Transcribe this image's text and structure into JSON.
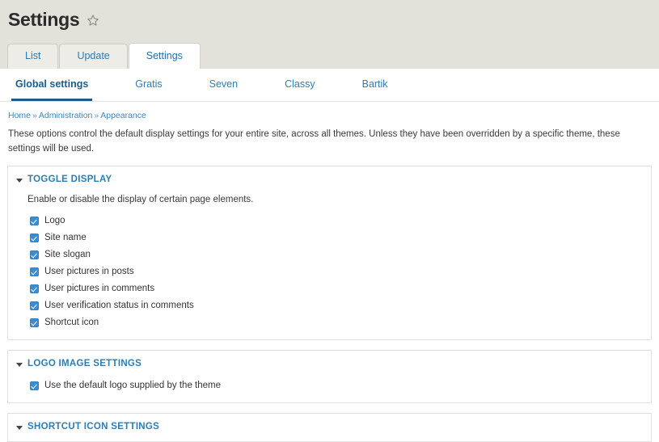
{
  "header": {
    "title": "Settings",
    "star_icon": "star-outline-icon"
  },
  "tabs": [
    {
      "label": "List",
      "active": false
    },
    {
      "label": "Update",
      "active": false
    },
    {
      "label": "Settings",
      "active": true
    }
  ],
  "subnav": [
    {
      "label": "Global settings",
      "active": true
    },
    {
      "label": "Gratis",
      "active": false
    },
    {
      "label": "Seven",
      "active": false
    },
    {
      "label": "Classy",
      "active": false
    },
    {
      "label": "Bartik",
      "active": false
    }
  ],
  "breadcrumb": {
    "items": [
      "Home",
      "Administration",
      "Appearance"
    ],
    "separator": "»"
  },
  "intro": "These options control the default display settings for your entire site, across all themes. Unless they have been overridden by a specific theme, these settings will be used.",
  "sections": [
    {
      "title": "TOGGLE DISPLAY",
      "description": "Enable or disable the display of certain page elements.",
      "checkboxes": [
        {
          "label": "Logo",
          "checked": true
        },
        {
          "label": "Site name",
          "checked": true
        },
        {
          "label": "Site slogan",
          "checked": true
        },
        {
          "label": "User pictures in posts",
          "checked": true
        },
        {
          "label": "User pictures in comments",
          "checked": true
        },
        {
          "label": "User verification status in comments",
          "checked": true
        },
        {
          "label": "Shortcut icon",
          "checked": true
        }
      ]
    },
    {
      "title": "LOGO IMAGE SETTINGS",
      "description": "",
      "checkboxes": [
        {
          "label": "Use the default logo supplied by the theme",
          "checked": true
        }
      ]
    },
    {
      "title": "SHORTCUT ICON SETTINGS",
      "description": "",
      "checkboxes": []
    }
  ],
  "colors": {
    "link": "#2c7db5",
    "header_bg": "#e2e1da",
    "checkbox_blue": "#3a8dd4",
    "active_underline": "#1a5c8e"
  }
}
